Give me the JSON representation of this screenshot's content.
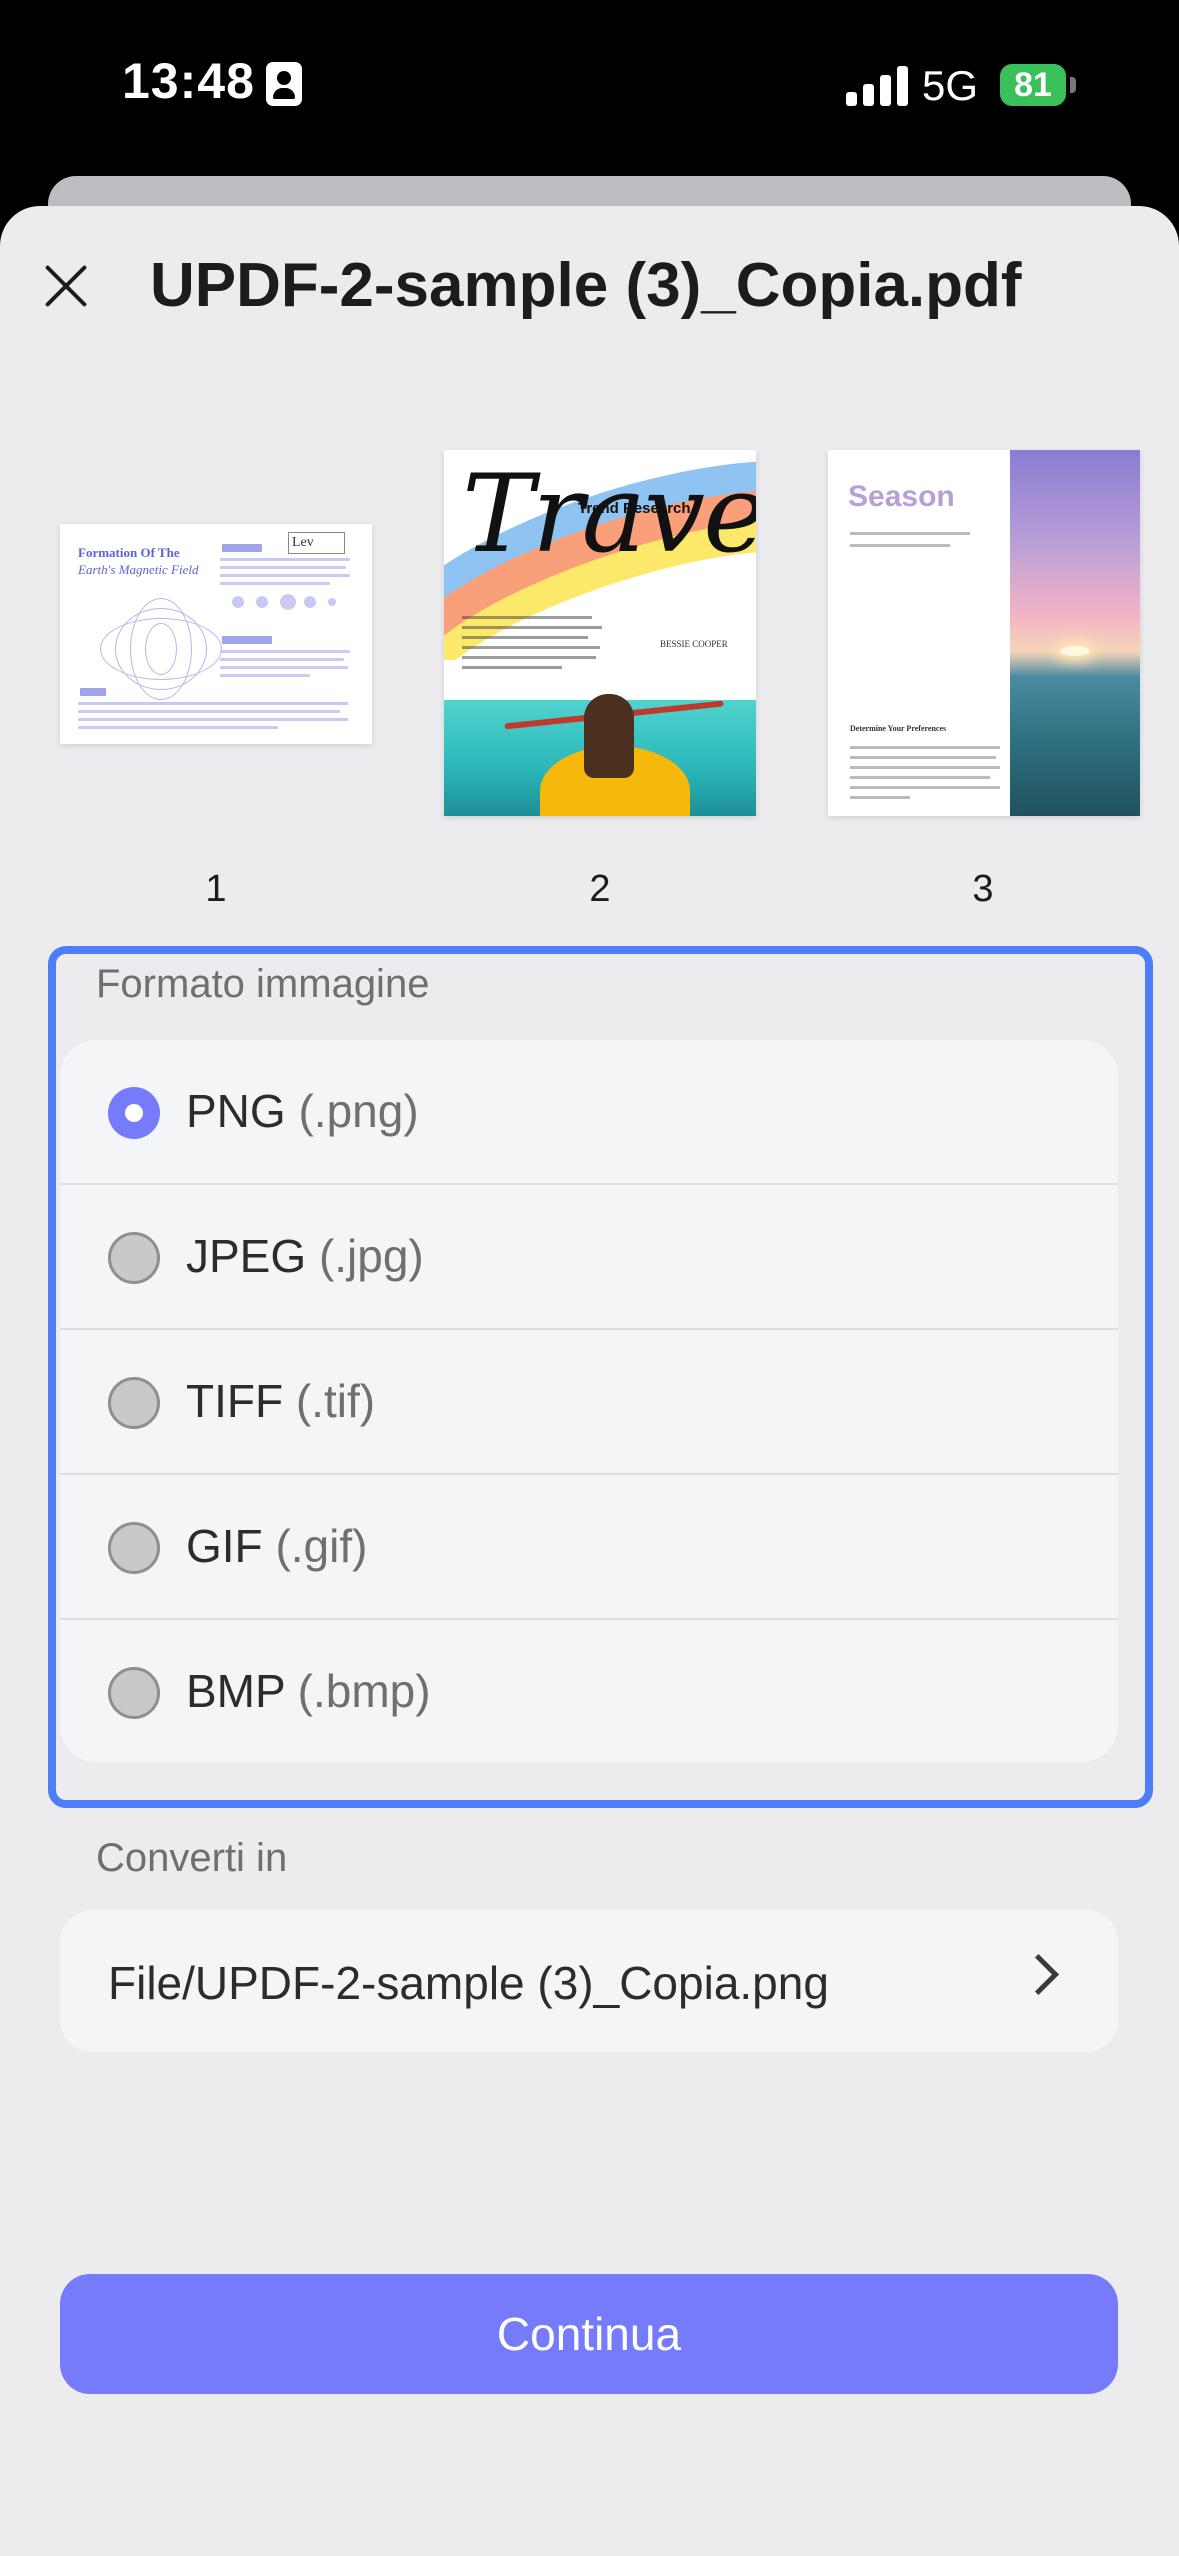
{
  "status_bar": {
    "time": "13:48",
    "network": "5G",
    "battery": "81"
  },
  "header": {
    "title": "UPDF-2-sample (3)_Copia.pdf"
  },
  "pages": [
    {
      "number": "1",
      "heading": "Formation Of The",
      "subheading": "Earth's Magnetic Field",
      "logo": "Lev"
    },
    {
      "number": "2",
      "title": "Travel",
      "subtitle": "Trend Research",
      "author": "BESSIE COOPER"
    },
    {
      "number": "3",
      "title": "Season",
      "heading": "Determine Your Preferences"
    }
  ],
  "image_format": {
    "label": "Formato immagine",
    "options": [
      {
        "name": "PNG",
        "ext": "(.png)",
        "selected": true
      },
      {
        "name": "JPEG",
        "ext": "(.jpg)",
        "selected": false
      },
      {
        "name": "TIFF",
        "ext": "(.tif)",
        "selected": false
      },
      {
        "name": "GIF",
        "ext": "(.gif)",
        "selected": false
      },
      {
        "name": "BMP",
        "ext": "(.bmp)",
        "selected": false
      }
    ]
  },
  "convert_to": {
    "label": "Converti in",
    "path": "File/UPDF-2-sample (3)_Copia.png"
  },
  "actions": {
    "continue": "Continua"
  },
  "colors": {
    "accent": "#757bfb",
    "selection_border": "#4d7ef7",
    "battery": "#3ac05b"
  }
}
